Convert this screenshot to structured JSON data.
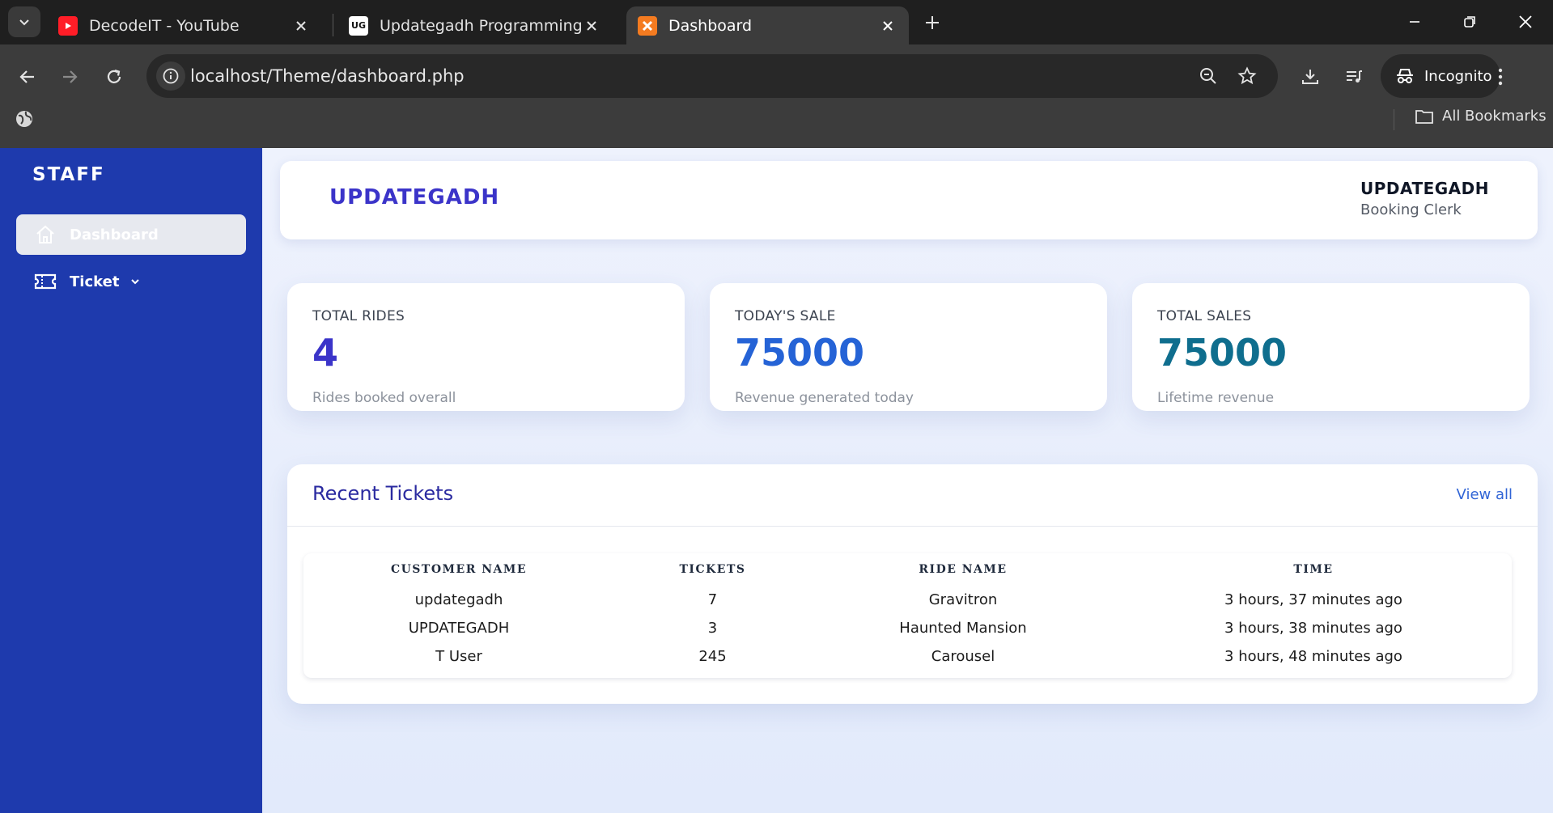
{
  "browser": {
    "tabs": [
      {
        "title": "DecodeIT - YouTube",
        "active": false
      },
      {
        "title": "Updategadh Programming - Up",
        "active": false
      },
      {
        "title": "Dashboard",
        "active": true
      }
    ],
    "url": "localhost/Theme/dashboard.php",
    "incognito_label": "Incognito",
    "bookmarks_label": "All Bookmarks"
  },
  "sidebar": {
    "brand": "STAFF",
    "items": [
      {
        "label": "Dashboard",
        "icon": "home-icon",
        "active": true
      },
      {
        "label": "Ticket",
        "icon": "ticket-icon",
        "active": false
      }
    ]
  },
  "header": {
    "title": "UPDATEGADH",
    "user_name": "UPDATEGADH",
    "user_role": "Booking Clerk"
  },
  "stats": [
    {
      "label": "TOTAL RIDES",
      "value": "4",
      "desc": "Rides booked overall",
      "color": "#3b34c9"
    },
    {
      "label": "TODAY'S SALE",
      "value": "75000",
      "desc": "Revenue generated today",
      "color": "#2563d6"
    },
    {
      "label": "TOTAL SALES",
      "value": "75000",
      "desc": "Lifetime revenue",
      "color": "#0f6e8e"
    }
  ],
  "recent_tickets": {
    "title": "Recent Tickets",
    "view_all": "View all",
    "columns": [
      "CUSTOMER NAME",
      "TICKETS",
      "RIDE NAME",
      "TIME"
    ],
    "rows": [
      [
        "updategadh",
        "7",
        "Gravitron",
        "3 hours, 37 minutes ago"
      ],
      [
        "UPDATEGADH",
        "3",
        "Haunted Mansion",
        "3 hours, 38 minutes ago"
      ],
      [
        "T User",
        "245",
        "Carousel",
        "3 hours, 48 minutes ago"
      ]
    ]
  },
  "colors": {
    "sidebar_bg": "#1e3aad",
    "accent": "#3b34c9",
    "link": "#3165d6"
  }
}
